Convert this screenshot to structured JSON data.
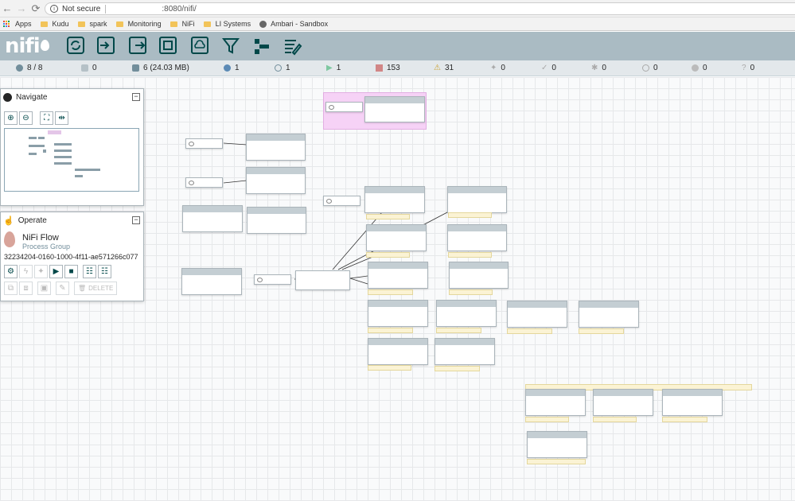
{
  "browser": {
    "security": "Not secure",
    "url": ":8080/nifi/",
    "bookmarks": [
      {
        "label": "Apps",
        "icon": "apps-grid-icon"
      },
      {
        "label": "Kudu",
        "icon": "folder-icon"
      },
      {
        "label": "spark",
        "icon": "folder-icon"
      },
      {
        "label": "Monitoring",
        "icon": "folder-icon"
      },
      {
        "label": "NiFi",
        "icon": "folder-icon"
      },
      {
        "label": "LI Systems",
        "icon": "folder-icon"
      },
      {
        "label": "Ambari - Sandbox",
        "icon": "globe-icon"
      }
    ]
  },
  "header": {
    "logo": "nifi"
  },
  "status": {
    "threads": "8 / 8",
    "transmitting": "0",
    "queued": "6 (24.03 MB)",
    "remote_transmitting": "1",
    "remote_not_transmitting": "1",
    "running": "1",
    "stopped": "153",
    "invalid": "31",
    "disabled": "0",
    "up_to_date": "0",
    "locally_modified": "0",
    "stale": "0",
    "locally_modified_stale": "0",
    "sync_failure": "0"
  },
  "navigate": {
    "title": "Navigate"
  },
  "operate": {
    "title": "Operate",
    "name": "NiFi Flow",
    "type": "Process Group",
    "id": "32234204-0160-1000-4f11-ae571266c077",
    "delete_label": "DELETE"
  },
  "colors": {
    "header": "#aabbc3",
    "brand": "#004849",
    "running": "#7dc7a0",
    "stopped": "#d18686",
    "invalid": "#cba335",
    "label": "#fbf3d4",
    "highlight": "#f6d2f6"
  }
}
